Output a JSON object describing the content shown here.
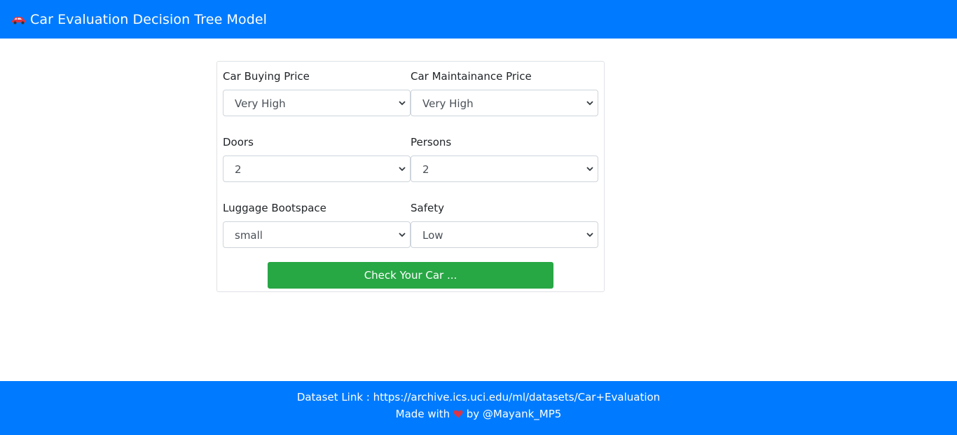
{
  "navbar": {
    "title": "Car Evaluation Decision Tree Model",
    "icon": "car-icon",
    "icon_color": "#dc3545"
  },
  "form": {
    "buying": {
      "label": "Car Buying Price",
      "value": "Very High"
    },
    "maint": {
      "label": "Car Maintainance Price",
      "value": "Very High"
    },
    "doors": {
      "label": "Doors",
      "value": "2"
    },
    "persons": {
      "label": "Persons",
      "value": "2"
    },
    "lug_boot": {
      "label": "Luggage Bootspace",
      "value": "small"
    },
    "safety": {
      "label": "Safety",
      "value": "Low"
    },
    "submit_label": "Check Your Car ..."
  },
  "footer": {
    "dataset_text": "Dataset Link : https://archive.ics.uci.edu/ml/datasets/Car+Evaluation",
    "made_with": "Made with",
    "by_text": "by @Mayank_MP5",
    "heart_icon": "heart-icon",
    "heart_color": "#dc3545"
  },
  "colors": {
    "primary": "#007bff",
    "success": "#28a745",
    "border": "#dee2e6"
  }
}
